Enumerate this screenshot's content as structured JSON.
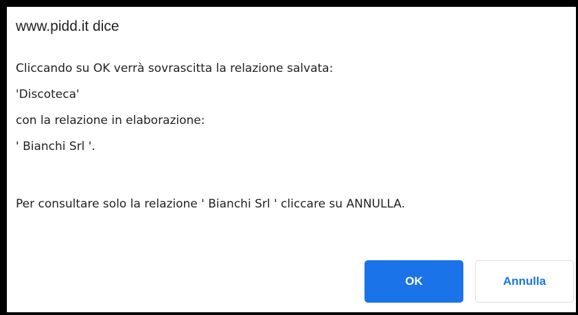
{
  "dialog": {
    "title": "www.pidd.it dice",
    "message_lines": [
      "Cliccando su OK verrà sovrascitta la relazione salvata:",
      "'Discoteca'",
      "con la relazione in elaborazione:",
      "' Bianchi Srl '.",
      "",
      "Per consultare solo la relazione ' Bianchi Srl ' cliccare su ANNULLA."
    ],
    "buttons": {
      "ok_label": "OK",
      "cancel_label": "Annulla"
    }
  },
  "colors": {
    "accent": "#1a73e8",
    "text": "#202124",
    "frame": "#000000"
  }
}
